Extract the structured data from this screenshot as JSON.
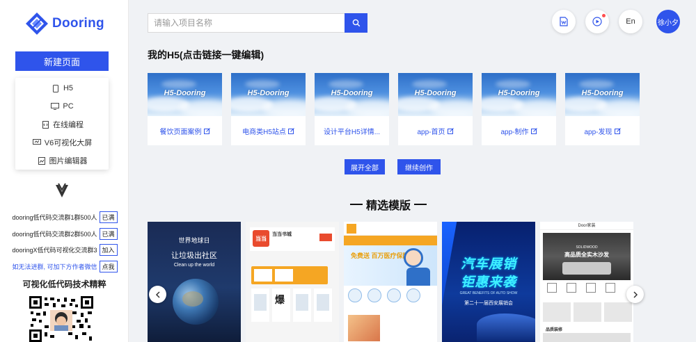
{
  "brand": {
    "name": "Dooring"
  },
  "sidebar": {
    "new_page_label": "新建页面",
    "menu": [
      {
        "label": "H5",
        "icon": "mobile-icon"
      },
      {
        "label": "PC",
        "icon": "desktop-icon"
      },
      {
        "label": "在线编程",
        "icon": "code-icon"
      },
      {
        "label": "V6可视化大屏",
        "icon": "screen-icon"
      },
      {
        "label": "图片编辑器",
        "icon": "image-icon"
      }
    ],
    "groups": [
      {
        "text": "dooring低代码交流群1群500人",
        "tag": "已满"
      },
      {
        "text": "dooring低代码交流群2群500人",
        "tag": "已满"
      },
      {
        "text": "dooringX低代码可视化交流群3",
        "tag": "加入"
      },
      {
        "text": "如无法进群, 可加下方作者微信",
        "tag": "点我"
      }
    ],
    "qr_title": "可视化低代码技术精粹"
  },
  "header": {
    "search_placeholder": "请输入项目名称",
    "lang_label": "En",
    "avatar_label": "徐小夕"
  },
  "main": {
    "my_h5_title": "我的H5(点击链接一键编辑)",
    "card_image_text": "H5-Dooring",
    "projects": [
      {
        "name": "餐饮页面案例"
      },
      {
        "name": "电商类H5站点"
      },
      {
        "name": "设计平台H5详情..."
      },
      {
        "name": "app-首页"
      },
      {
        "name": "app-制作"
      },
      {
        "name": "app-发现"
      }
    ],
    "expand_all_label": "展开全部",
    "continue_label": "继续创作",
    "featured_title": "精选模版"
  },
  "templates": {
    "earth": {
      "line1": "世界地球日",
      "line2": "让垃圾出社区",
      "line3": "Clean up the world"
    },
    "book": {
      "name": "当当书城",
      "logo": "当当"
    },
    "medical": {
      "headline": "免费送 百万医疗保险"
    },
    "car": {
      "line1": "汽车展销",
      "line2": "钜惠来袭",
      "sub": "GREAT BENEFITS OF AUTO SHOW",
      "line3": "第二十一届西安展销会"
    },
    "home": {
      "top": "Door家装",
      "brand": "SOLIDWOOD",
      "title": "高品质全实木沙发",
      "section": "品质装修"
    }
  },
  "colors": {
    "accent": "#2f54eb"
  }
}
